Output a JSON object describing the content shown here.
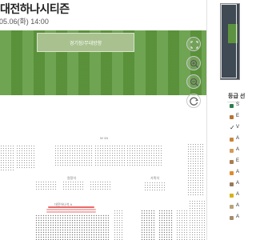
{
  "header": {
    "title": "대전하나시티즌",
    "date": "05.06(화) 14:00"
  },
  "field": {
    "stage_label": "경기장/무대방향"
  },
  "map": {
    "sections": {
      "w1n": "W 1N",
      "away": "원정석",
      "family": "가족석",
      "red_zone": "대전하나석 A"
    }
  },
  "controls": {
    "fullscreen": "fullscreen-icon",
    "zoom_in": "zoom-in-icon",
    "zoom_out": "zoom-out-icon",
    "refresh": "refresh-icon"
  },
  "panel": {
    "grade_title": "등급 선",
    "legend": [
      {
        "label": "S",
        "color": "#2e7d4f",
        "chevron": false
      },
      {
        "label": "E",
        "color": "#b87333",
        "chevron": false
      },
      {
        "label": "V",
        "color": "#ffffff",
        "chevron": true
      },
      {
        "label": "A",
        "color": "#c9853a",
        "chevron": false
      },
      {
        "label": "A",
        "color": "#d49a5a",
        "chevron": false
      },
      {
        "label": "E",
        "color": "#a97c50",
        "chevron": false
      },
      {
        "label": "A",
        "color": "#e08b2b",
        "chevron": false
      },
      {
        "label": "A",
        "color": "#9a7a5a",
        "chevron": false
      },
      {
        "label": "A",
        "color": "#d4b21c",
        "chevron": false
      },
      {
        "label": "A",
        "color": "#b8a27a",
        "chevron": false
      },
      {
        "label": "A",
        "color": "#a98a6a",
        "chevron": false
      }
    ]
  },
  "colors": {
    "field": "#5f9a3e",
    "highlight": "#e86a6a"
  }
}
